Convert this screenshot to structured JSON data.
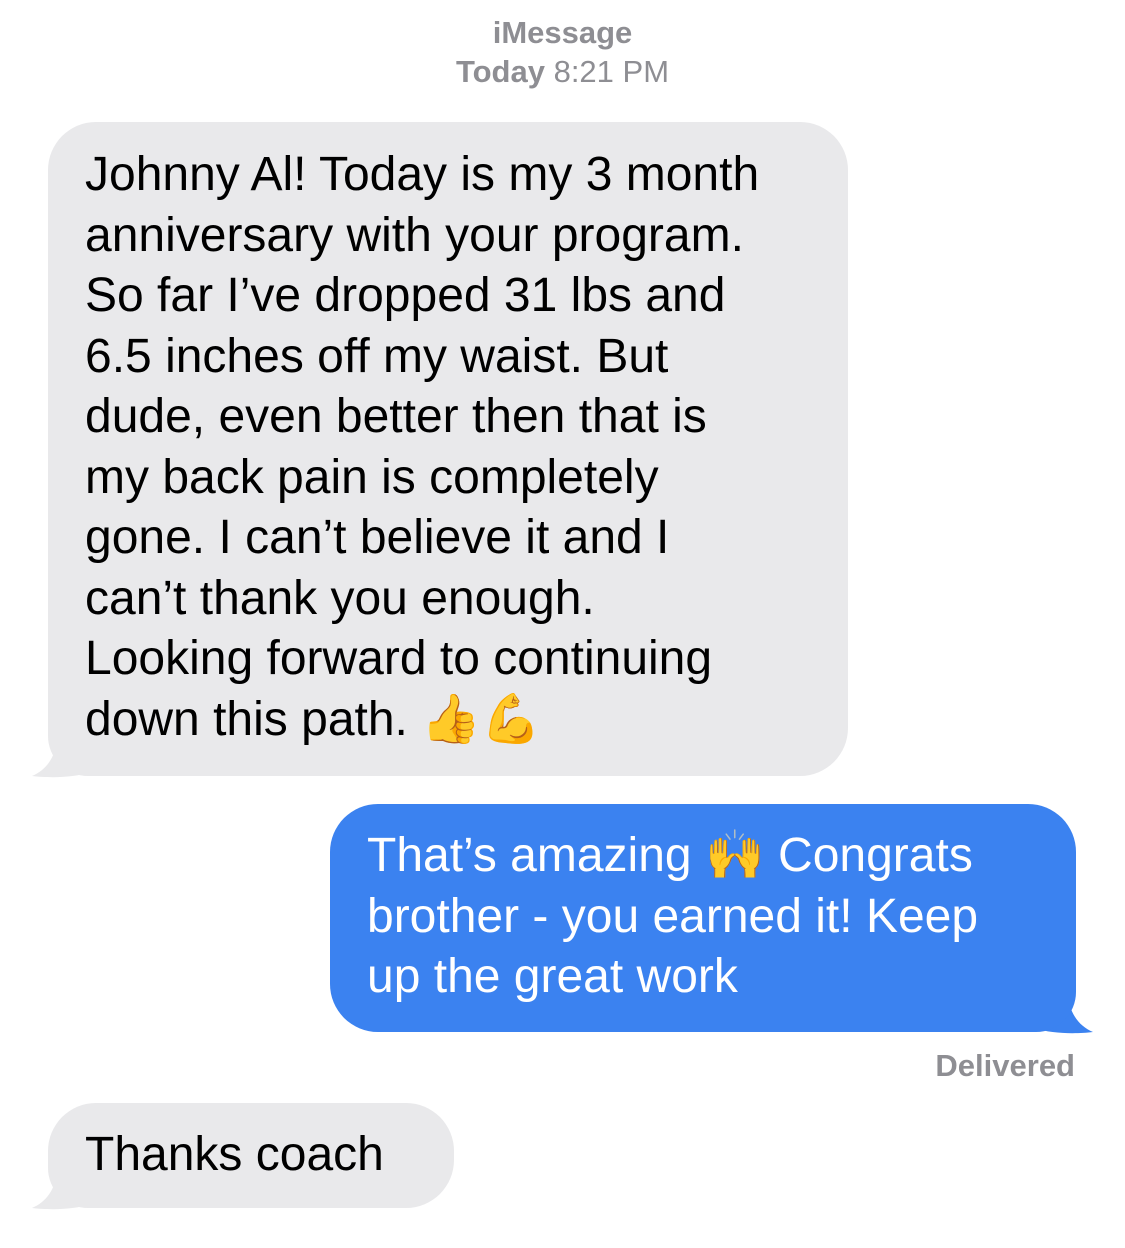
{
  "header": {
    "service": "iMessage",
    "day": "Today",
    "time": "8:21 PM"
  },
  "messages": [
    {
      "direction": "incoming",
      "text": "Johnny Al! Today is my 3 month\nanniversary with your program.\nSo far I’ve dropped 31 lbs and\n6.5 inches off my waist. But\ndude, even better then that is\nmy back pain is completely\ngone. I can’t believe it and I\ncan’t thank you enough.\nLooking forward to continuing\ndown this path. 👍💪"
    },
    {
      "direction": "outgoing",
      "text": "That’s amazing 🙌 Congrats\nbrother - you earned it! Keep\nup the great work"
    },
    {
      "direction": "incoming",
      "text": "Thanks coach"
    }
  ],
  "status": {
    "delivered": "Delivered"
  },
  "colors": {
    "incoming_bubble": "#e9e9eb",
    "outgoing_bubble": "#3b82f0",
    "meta_text": "#8e8e93"
  }
}
